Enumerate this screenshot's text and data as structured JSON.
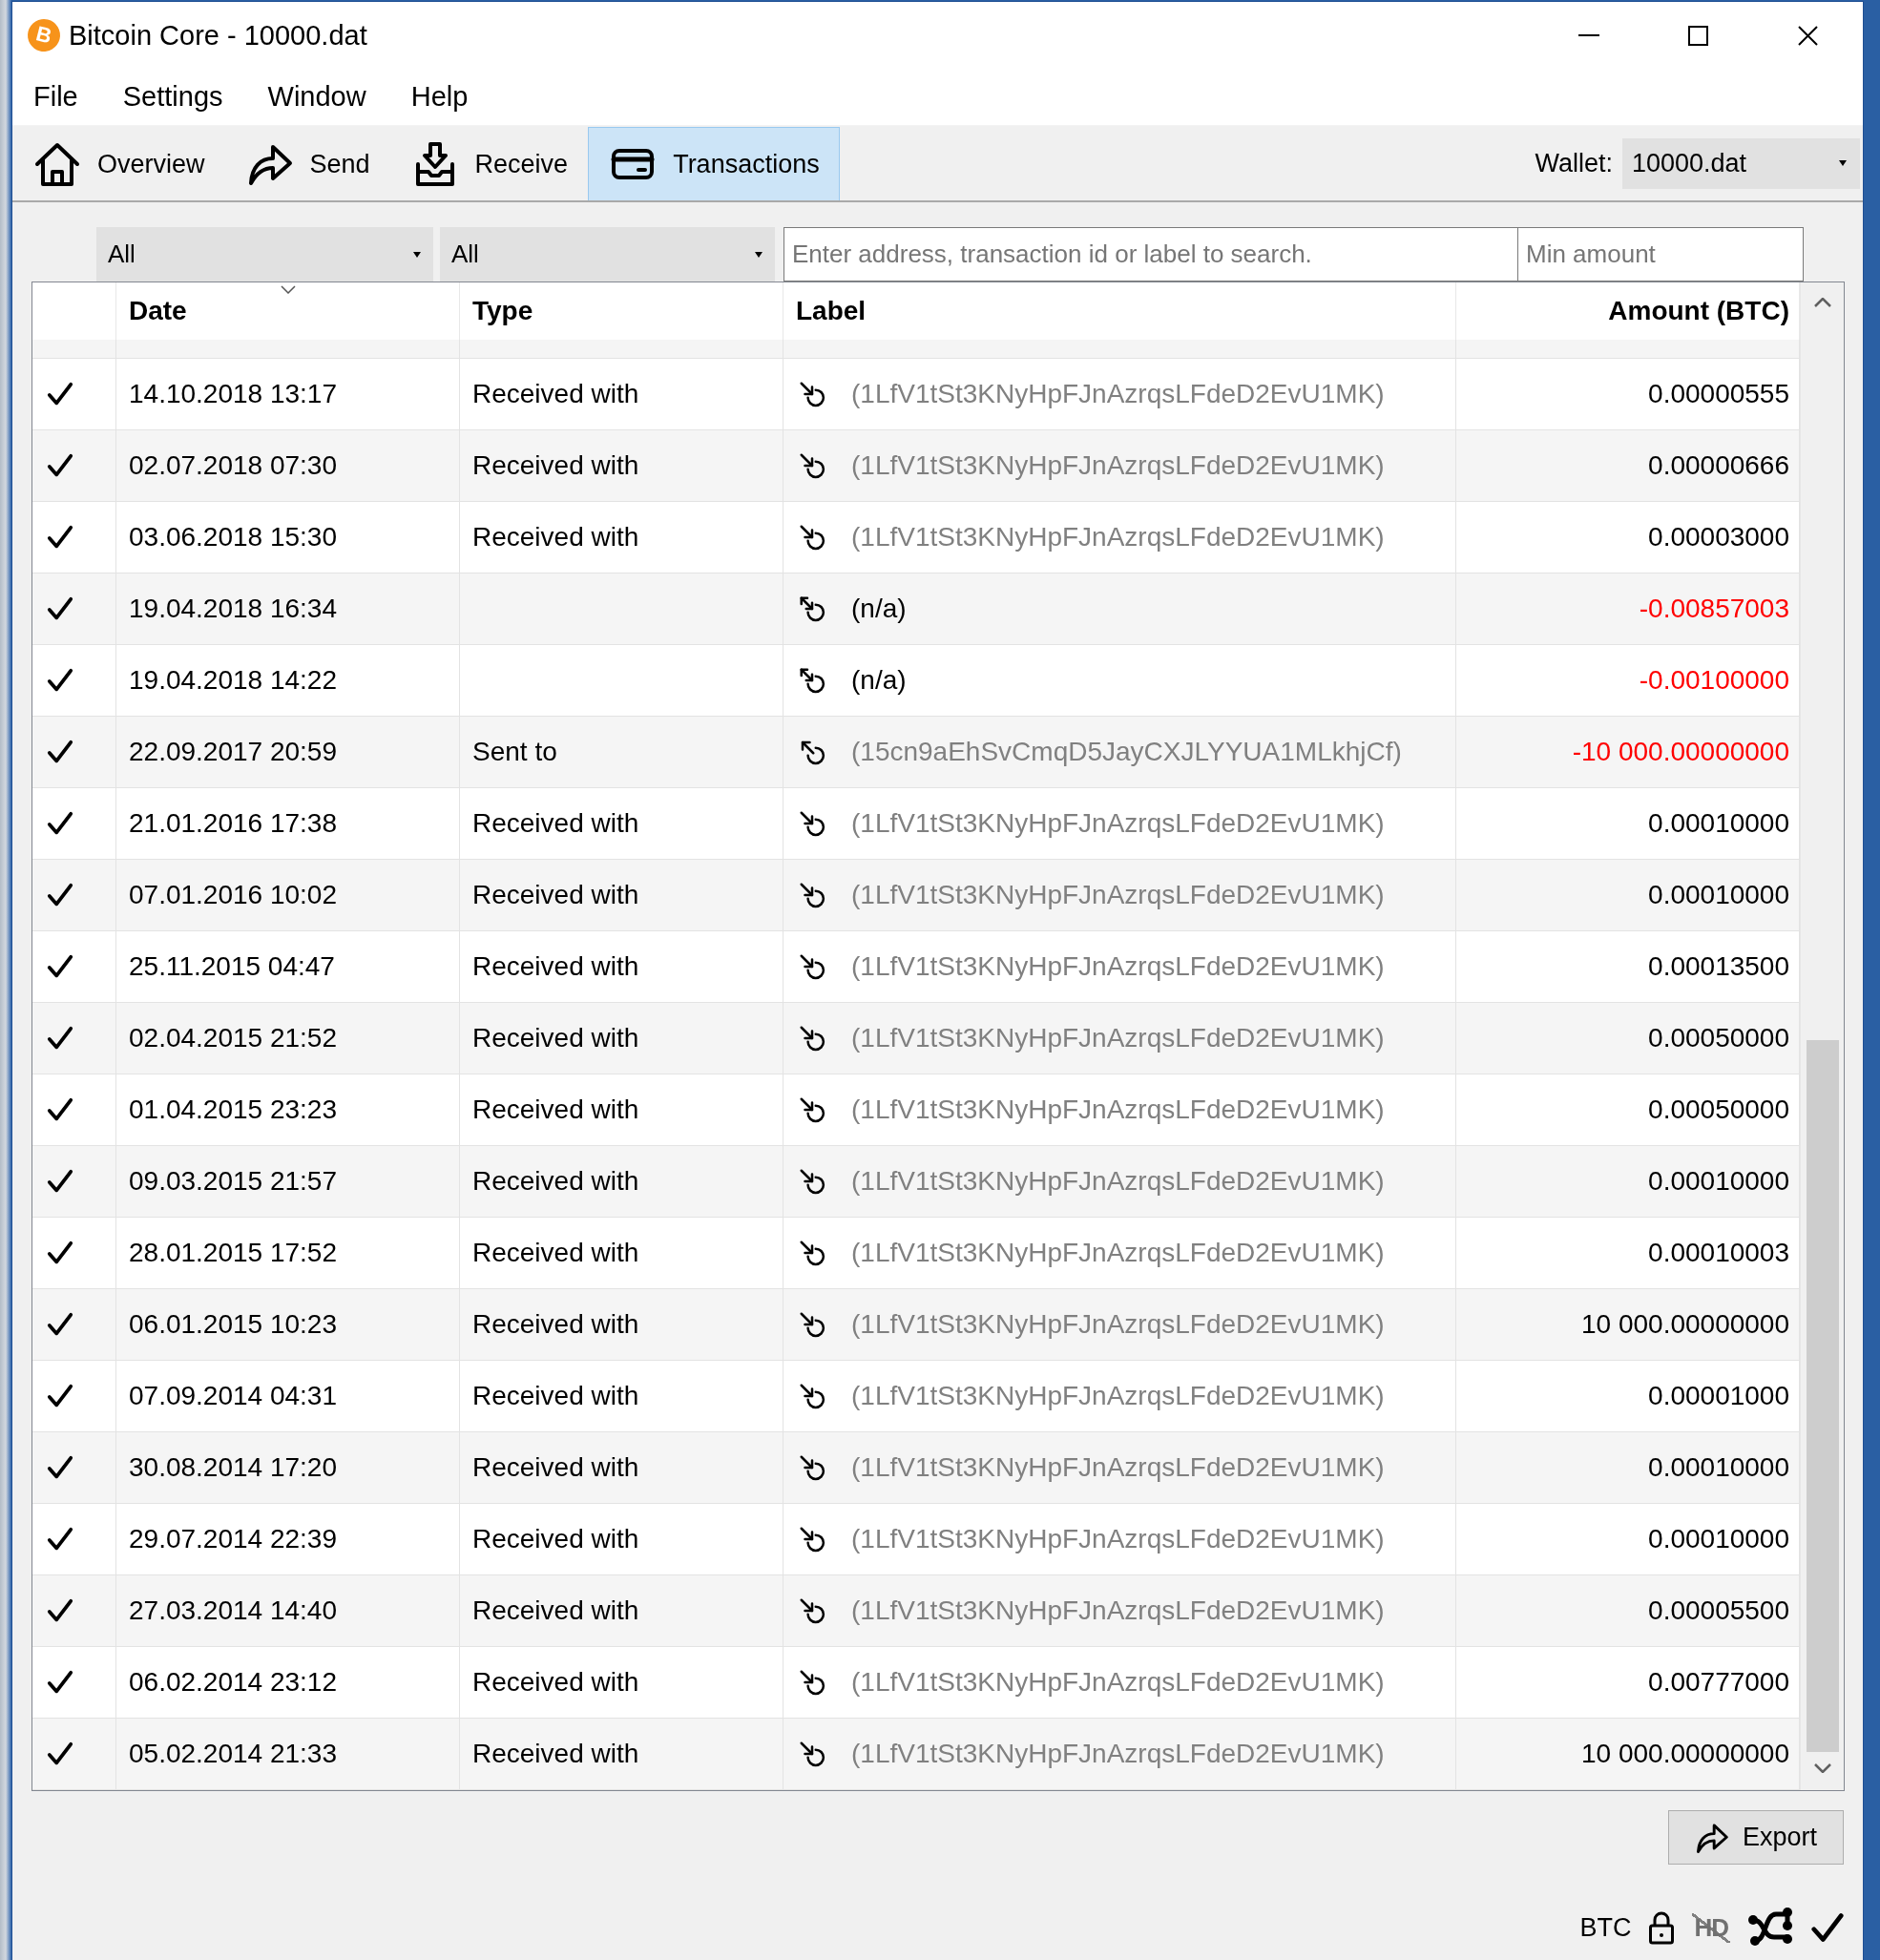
{
  "window": {
    "logo": "B",
    "title": "Bitcoin Core - 10000.dat"
  },
  "menu": [
    "File",
    "Settings",
    "Window",
    "Help"
  ],
  "toolbar": {
    "tabs": [
      {
        "kind": "overview",
        "label": "Overview",
        "selected": false
      },
      {
        "kind": "send",
        "label": "Send",
        "selected": false
      },
      {
        "kind": "receive",
        "label": "Receive",
        "selected": false
      },
      {
        "kind": "transactions",
        "label": "Transactions",
        "selected": true
      }
    ],
    "wallet": {
      "label": "Wallet:",
      "value": "10000.dat"
    }
  },
  "filters": {
    "date": "All",
    "type": "All",
    "search": {
      "placeholder": "Enter address, transaction id or label to search."
    },
    "min_amount": {
      "placeholder": "Min amount"
    }
  },
  "table": {
    "columns": [
      {
        "label": "Date",
        "sorted": true
      },
      {
        "label": "Type",
        "sorted": false
      },
      {
        "label": "Label",
        "sorted": false
      },
      {
        "label": "Amount (BTC)",
        "sorted": false
      }
    ],
    "rows": [
      {
        "confirmed": true,
        "date": "14.10.2018 13:17",
        "type": "Received with",
        "kind": "received",
        "label": "(1LfV1tSt3KNyHpFJnAzrqsLFdeD2EvU1MK)",
        "amount": "0.00000555"
      },
      {
        "confirmed": true,
        "date": "02.07.2018 07:30",
        "type": "Received with",
        "kind": "received",
        "label": "(1LfV1tSt3KNyHpFJnAzrqsLFdeD2EvU1MK)",
        "amount": "0.00000666"
      },
      {
        "confirmed": true,
        "date": "03.06.2018 15:30",
        "type": "Received with",
        "kind": "received",
        "label": "(1LfV1tSt3KNyHpFJnAzrqsLFdeD2EvU1MK)",
        "amount": "0.00003000"
      },
      {
        "confirmed": true,
        "date": "19.04.2018 16:34",
        "kind": "self",
        "label": "(n/a)",
        "amount": "-0.00857003"
      },
      {
        "confirmed": true,
        "date": "19.04.2018 14:22",
        "kind": "self",
        "label": "(n/a)",
        "amount": "-0.00100000"
      },
      {
        "confirmed": true,
        "date": "22.09.2017 20:59",
        "type": "Sent to",
        "kind": "sent",
        "label": "(15cn9aEhSvCmqD5JayCXJLYYUA1MLkhjCf)",
        "amount": "-10 000.00000000"
      },
      {
        "confirmed": true,
        "date": "21.01.2016 17:38",
        "type": "Received with",
        "kind": "received",
        "label": "(1LfV1tSt3KNyHpFJnAzrqsLFdeD2EvU1MK)",
        "amount": "0.00010000"
      },
      {
        "confirmed": true,
        "date": "07.01.2016 10:02",
        "type": "Received with",
        "kind": "received",
        "label": "(1LfV1tSt3KNyHpFJnAzrqsLFdeD2EvU1MK)",
        "amount": "0.00010000"
      },
      {
        "confirmed": true,
        "date": "25.11.2015 04:47",
        "type": "Received with",
        "kind": "received",
        "label": "(1LfV1tSt3KNyHpFJnAzrqsLFdeD2EvU1MK)",
        "amount": "0.00013500"
      },
      {
        "confirmed": true,
        "date": "02.04.2015 21:52",
        "type": "Received with",
        "kind": "received",
        "label": "(1LfV1tSt3KNyHpFJnAzrqsLFdeD2EvU1MK)",
        "amount": "0.00050000"
      },
      {
        "confirmed": true,
        "date": "01.04.2015 23:23",
        "type": "Received with",
        "kind": "received",
        "label": "(1LfV1tSt3KNyHpFJnAzrqsLFdeD2EvU1MK)",
        "amount": "0.00050000"
      },
      {
        "confirmed": true,
        "date": "09.03.2015 21:57",
        "type": "Received with",
        "kind": "received",
        "label": "(1LfV1tSt3KNyHpFJnAzrqsLFdeD2EvU1MK)",
        "amount": "0.00010000"
      },
      {
        "confirmed": true,
        "date": "28.01.2015 17:52",
        "type": "Received with",
        "kind": "received",
        "label": "(1LfV1tSt3KNyHpFJnAzrqsLFdeD2EvU1MK)",
        "amount": "0.00010003"
      },
      {
        "confirmed": true,
        "date": "06.01.2015 10:23",
        "type": "Received with",
        "kind": "received",
        "label": "(1LfV1tSt3KNyHpFJnAzrqsLFdeD2EvU1MK)",
        "amount": "10 000.00000000"
      },
      {
        "confirmed": true,
        "date": "07.09.2014 04:31",
        "type": "Received with",
        "kind": "received",
        "label": "(1LfV1tSt3KNyHpFJnAzrqsLFdeD2EvU1MK)",
        "amount": "0.00001000"
      },
      {
        "confirmed": true,
        "date": "30.08.2014 17:20",
        "type": "Received with",
        "kind": "received",
        "label": "(1LfV1tSt3KNyHpFJnAzrqsLFdeD2EvU1MK)",
        "amount": "0.00010000"
      },
      {
        "confirmed": true,
        "date": "29.07.2014 22:39",
        "type": "Received with",
        "kind": "received",
        "label": "(1LfV1tSt3KNyHpFJnAzrqsLFdeD2EvU1MK)",
        "amount": "0.00010000"
      },
      {
        "confirmed": true,
        "date": "27.03.2014 14:40",
        "type": "Received with",
        "kind": "received",
        "label": "(1LfV1tSt3KNyHpFJnAzrqsLFdeD2EvU1MK)",
        "amount": "0.00005500"
      },
      {
        "confirmed": true,
        "date": "06.02.2014 23:12",
        "type": "Received with",
        "kind": "received",
        "label": "(1LfV1tSt3KNyHpFJnAzrqsLFdeD2EvU1MK)",
        "amount": "0.00777000"
      },
      {
        "confirmed": true,
        "date": "05.02.2014 21:33",
        "type": "Received with",
        "kind": "received",
        "label": "(1LfV1tSt3KNyHpFJnAzrqsLFdeD2EvU1MK)",
        "amount": "10 000.00000000"
      }
    ]
  },
  "export_button": {
    "label": "Export"
  },
  "status_bar": {
    "unit": "BTC",
    "hd": {
      "label": "HD",
      "enabled": false
    }
  }
}
